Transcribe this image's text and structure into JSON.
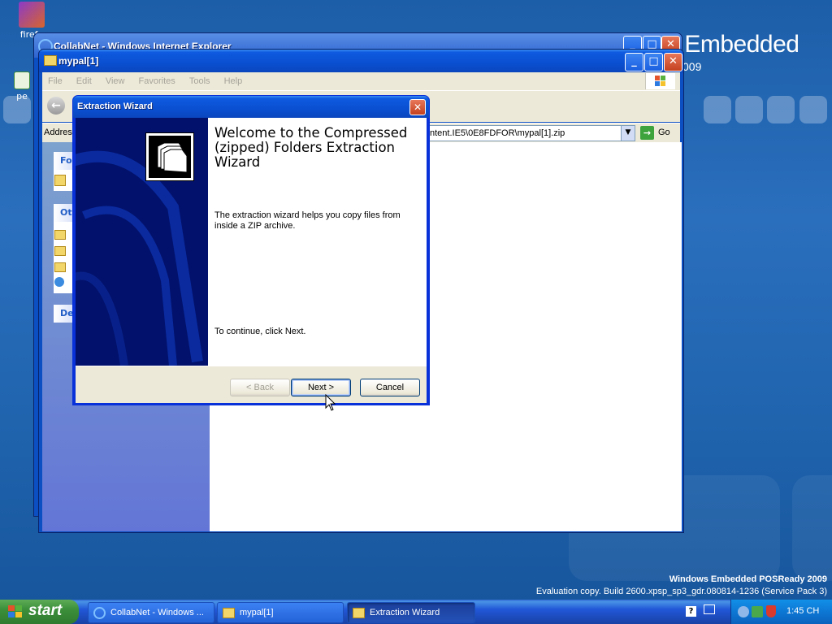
{
  "desktop": {
    "brand_text": "s Embedded",
    "brand_year": "009",
    "watermark_title": "Windows Embedded POSReady 2009",
    "watermark_build": "Evaluation copy. Build 2600.xpsp_sp3_gdr.080814-1236 (Service Pack 3)",
    "icons": [
      {
        "label": "firefo",
        "icon": "firefox-icon"
      },
      {
        "label": "pe",
        "icon": "program-icon"
      }
    ]
  },
  "ie_window": {
    "title": "CollabNet - Windows Internet Explorer"
  },
  "explorer": {
    "title": "mypal[1]",
    "menu": [
      "File",
      "Edit",
      "View",
      "Favorites",
      "Tools",
      "Help"
    ],
    "address_label": "Addres",
    "address_value": "ntent.IE5\\0E8FDFOR\\mypal[1].zip",
    "go_label": "Go",
    "sidebar_sections": [
      "Fol",
      "Otl",
      "De"
    ]
  },
  "wizard": {
    "title": "Extraction Wizard",
    "heading": "Welcome to the Compressed (zipped) Folders Extraction Wizard",
    "body": "The extraction wizard helps you copy files from inside a ZIP archive.",
    "continue_text": "To continue, click Next.",
    "back_label": "< Back",
    "next_label": "Next >",
    "cancel_label": "Cancel"
  },
  "taskbar": {
    "start_label": "start",
    "tasks": [
      {
        "label": "CollabNet - Windows ...",
        "icon": "ie-icon",
        "active": false
      },
      {
        "label": "mypal[1]",
        "icon": "folder-icon",
        "active": false
      },
      {
        "label": "Extraction Wizard",
        "icon": "folder-icon",
        "active": true
      }
    ],
    "clock": "1:45 CH"
  },
  "colors": {
    "desktop": "#1f63ad",
    "title_bar": "#0a4fd1",
    "dialog_face": "#ece9d8",
    "wizard_side": "#02116b"
  }
}
